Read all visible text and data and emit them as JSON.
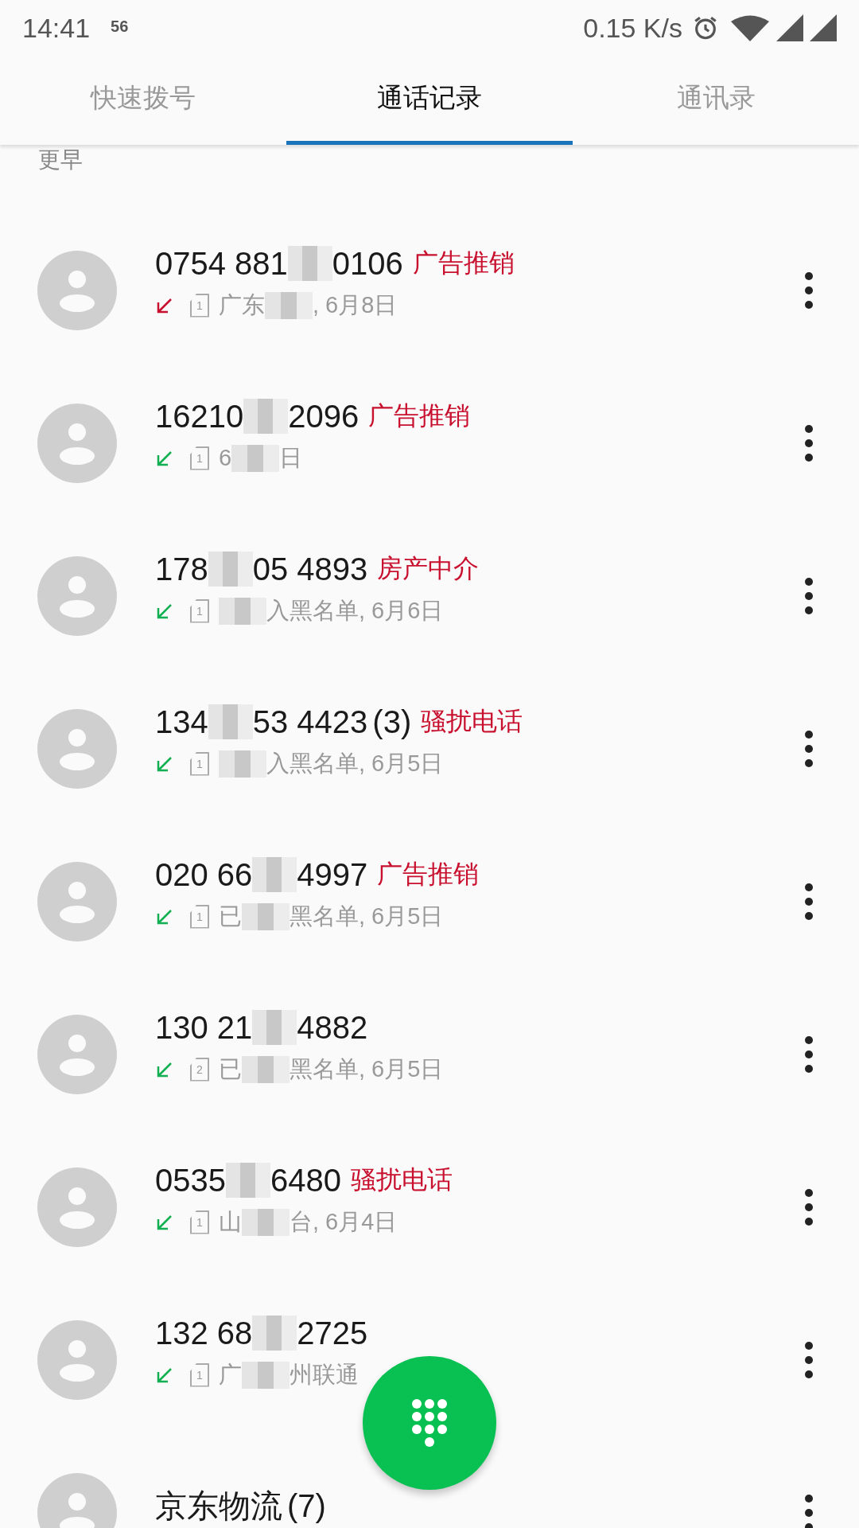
{
  "status_bar": {
    "time": "14:41",
    "badge": "56",
    "speed": "0.15 K/s"
  },
  "tabs": [
    {
      "label": "快速拨号",
      "selected": false
    },
    {
      "label": "通话记录",
      "selected": true
    },
    {
      "label": "通讯录",
      "selected": false
    }
  ],
  "section_header": "更早",
  "calls": [
    {
      "missed": true,
      "number": [
        {
          "kind": "text",
          "text": "0754 881"
        },
        {
          "kind": "mosaic"
        },
        {
          "kind": "text",
          "text": "0106"
        }
      ],
      "tag": "广告推销",
      "sim": "1",
      "detail": [
        {
          "kind": "text",
          "text": "广东"
        },
        {
          "kind": "mosaic"
        },
        {
          "kind": "text",
          "text": ", 6月8日"
        }
      ]
    },
    {
      "missed": false,
      "number": [
        {
          "kind": "text",
          "text": "16210"
        },
        {
          "kind": "mosaic"
        },
        {
          "kind": "text",
          "text": "2096"
        }
      ],
      "tag": "广告推销",
      "sim": "1",
      "detail": [
        {
          "kind": "text",
          "text": "6"
        },
        {
          "kind": "mosaic"
        },
        {
          "kind": "text",
          "text": "日"
        }
      ]
    },
    {
      "missed": false,
      "number": [
        {
          "kind": "text",
          "text": "178"
        },
        {
          "kind": "mosaic"
        },
        {
          "kind": "text",
          "text": "05 4893"
        }
      ],
      "tag": "房产中介",
      "sim": "1",
      "detail": [
        {
          "kind": "mosaic"
        },
        {
          "kind": "text",
          "text": "入黑名单, 6月6日"
        }
      ]
    },
    {
      "missed": false,
      "number": [
        {
          "kind": "text",
          "text": "134"
        },
        {
          "kind": "mosaic"
        },
        {
          "kind": "text",
          "text": "53 4423"
        }
      ],
      "count": "(3)",
      "tag": "骚扰电话",
      "sim": "1",
      "detail": [
        {
          "kind": "mosaic"
        },
        {
          "kind": "text",
          "text": "入黑名单, 6月5日"
        }
      ]
    },
    {
      "missed": false,
      "number": [
        {
          "kind": "text",
          "text": "020 66"
        },
        {
          "kind": "mosaic"
        },
        {
          "kind": "text",
          "text": "4997"
        }
      ],
      "tag": "广告推销",
      "sim": "1",
      "detail": [
        {
          "kind": "text",
          "text": "已"
        },
        {
          "kind": "mosaic"
        },
        {
          "kind": "text",
          "text": "黑名单, 6月5日"
        }
      ]
    },
    {
      "missed": false,
      "number": [
        {
          "kind": "text",
          "text": "130 21"
        },
        {
          "kind": "mosaic"
        },
        {
          "kind": "text",
          "text": "4882"
        }
      ],
      "sim": "2",
      "detail": [
        {
          "kind": "text",
          "text": "已"
        },
        {
          "kind": "mosaic"
        },
        {
          "kind": "text",
          "text": "黑名单, 6月5日"
        }
      ]
    },
    {
      "missed": false,
      "number": [
        {
          "kind": "text",
          "text": "0535"
        },
        {
          "kind": "mosaic"
        },
        {
          "kind": "text",
          "text": "6480"
        }
      ],
      "tag": "骚扰电话",
      "sim": "1",
      "detail": [
        {
          "kind": "text",
          "text": "山"
        },
        {
          "kind": "mosaic"
        },
        {
          "kind": "text",
          "text": "台, 6月4日"
        }
      ]
    },
    {
      "missed": false,
      "number": [
        {
          "kind": "text",
          "text": "132 68"
        },
        {
          "kind": "mosaic"
        },
        {
          "kind": "text",
          "text": "2725"
        }
      ],
      "sim": "1",
      "detail": [
        {
          "kind": "text",
          "text": "广"
        },
        {
          "kind": "mosaic"
        },
        {
          "kind": "text",
          "text": "州联通"
        }
      ]
    },
    {
      "number": [
        {
          "kind": "text",
          "text": "京东物流"
        }
      ],
      "count": "(7)"
    }
  ]
}
